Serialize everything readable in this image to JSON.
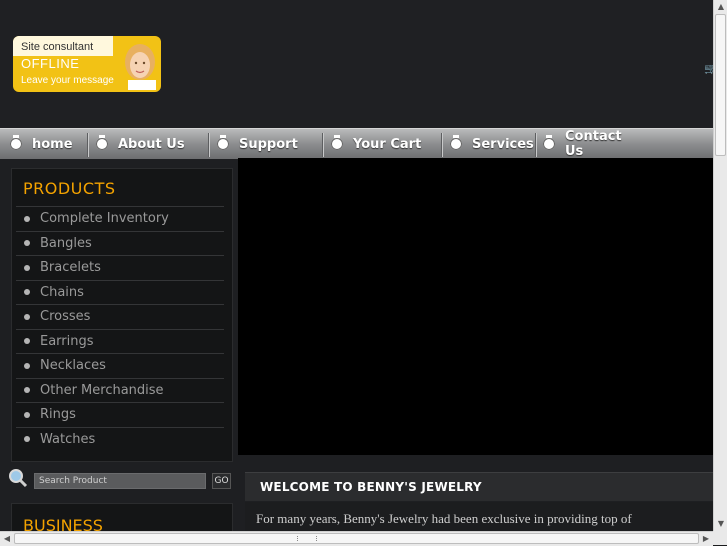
{
  "consultant": {
    "line1": "Site consultant",
    "status": "OFFLINE",
    "action": "Leave your message"
  },
  "nav": {
    "items": [
      {
        "label": "home"
      },
      {
        "label": "About Us"
      },
      {
        "label": "Support"
      },
      {
        "label": "Your Cart"
      },
      {
        "label": "Services"
      },
      {
        "label": "Contact Us",
        "line1": "Contact",
        "line2": "Us"
      }
    ]
  },
  "products": {
    "heading": "PRODUCTS",
    "items": [
      "Complete Inventory",
      "Bangles",
      "Bracelets",
      "Chains",
      "Crosses",
      "Earrings",
      "Necklaces",
      "Other Merchandise",
      "Rings",
      "Watches"
    ]
  },
  "search": {
    "placeholder": "Search Product",
    "button": "GO",
    "icon": "magnifier-icon"
  },
  "business": {
    "heading": "BUSINESS"
  },
  "welcome": {
    "title": "WELCOME TO BENNY'S JEWELRY",
    "text": "For many years, Benny's Jewelry had been exclusive in providing top of"
  },
  "colors": {
    "accent": "#f3a200",
    "background": "#1e1f22",
    "nav": "#8c8d8f"
  }
}
